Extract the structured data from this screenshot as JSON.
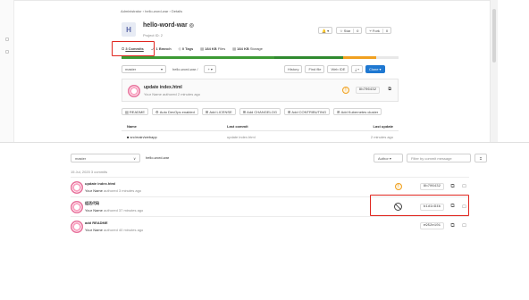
{
  "project": {
    "breadcrumb": "Administrator › hello-word-war › Details",
    "avatar_letter": "H",
    "name": "hello-word-war",
    "visibility_icon": "globe-icon",
    "project_id": "Project ID: 2",
    "notify_label": "🔔 ▾",
    "star_label": "☆ Star",
    "star_count": "0",
    "fork_label": "⑂ Fork",
    "fork_count": "0"
  },
  "stats": {
    "commits": "3 Commits",
    "branches": "1 Branch",
    "tags": "0 Tags",
    "files_size": "184 KB",
    "files_label": "Files",
    "storage_size": "184 KB",
    "storage_label": "Storage"
  },
  "language_colors": [
    "#3c9a34",
    "#2f8a2f",
    "#f0a020",
    "#e8e8e8"
  ],
  "toolbar": {
    "branch": "master",
    "path": "hello-word-war /",
    "add_label": "+ ▾",
    "history": "History",
    "find_file": "Find file",
    "web_ide": "Web IDE",
    "download": "⤓ ▾",
    "clone": "Clone ▾"
  },
  "last_commit": {
    "title": "update index.html",
    "meta": "Your Name authored 2 minutes ago",
    "sha": "8b706432",
    "copy_icon": "copy-icon"
  },
  "quick_actions": [
    "README",
    "Auto DevOps enabled",
    "Add LICENSE",
    "Add CHANGELOG",
    "Add CONTRIBUTING",
    "Add Kubernetes cluster"
  ],
  "file_table": {
    "headers": {
      "name": "Name",
      "commit": "Last commit",
      "update": "Last update"
    },
    "rows": [
      {
        "name": "src/main/webapp",
        "commit": "update index.html",
        "update": "2 minutes ago"
      }
    ]
  },
  "commits_page": {
    "branch": "master",
    "path": "hello-word-war",
    "author_filter": "Author ▾",
    "search_placeholder": "Filter by commit message",
    "day_header": "15 Jul, 2020 3 commits",
    "commits": [
      {
        "title": "update index.html",
        "author": "Your Name",
        "time": "authored 3 minutes ago",
        "status": "warning",
        "sha": "8b706432"
      },
      {
        "title": "组活代码",
        "author": "Your Name",
        "time": "authored 37 minutes ago",
        "status": "canceled",
        "sha": "b1d1c94b"
      },
      {
        "title": "add README",
        "author": "Your Name",
        "time": "authored 40 minutes ago",
        "status": "none",
        "sha": "e952e101"
      }
    ]
  }
}
